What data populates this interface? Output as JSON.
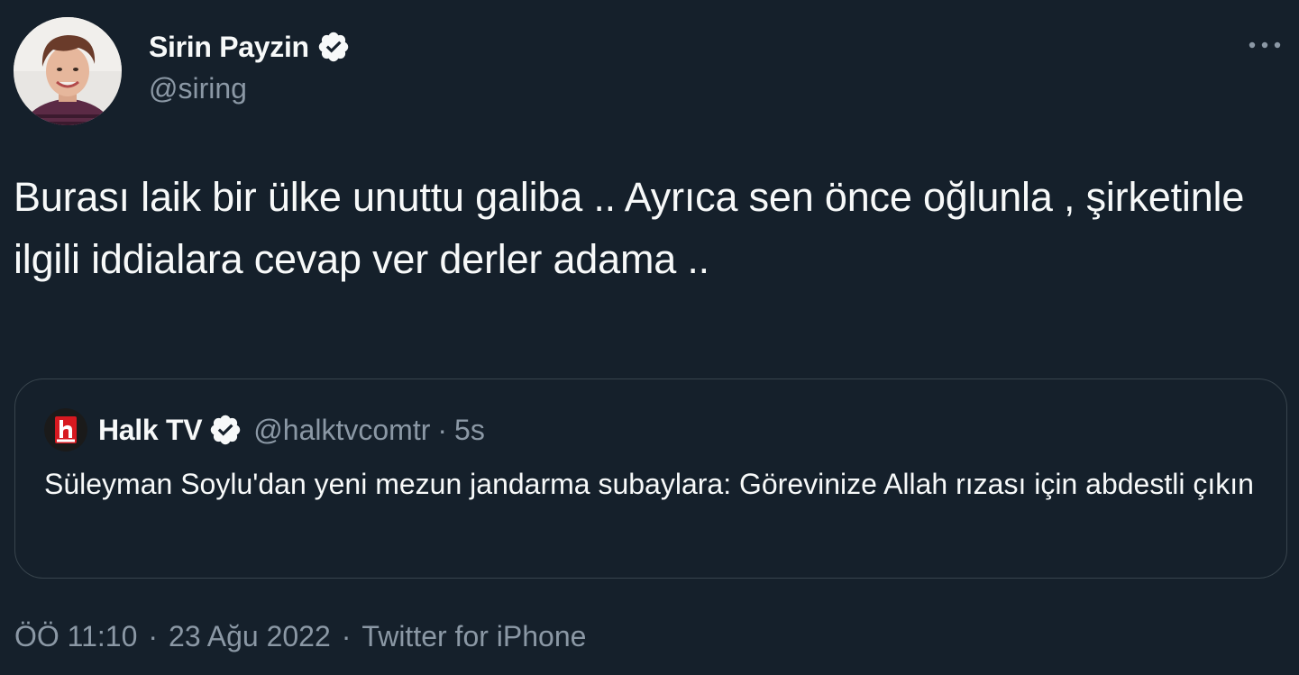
{
  "author": {
    "display_name": "Sirin Payzin",
    "handle": "@siring",
    "verified": true,
    "avatar": "profile-photo"
  },
  "tweet": {
    "text": "Burası laik bir ülke unuttu galiba .. Ayrıca sen önce oğlunla , şirketinle ilgili iddialara cevap ver derler adama .."
  },
  "quoted_tweet": {
    "display_name": "Halk TV",
    "handle": "@halktvcomtr",
    "separator": "·",
    "time": "5s",
    "verified": true,
    "avatar": "halk-tv-logo",
    "text": "Süleyman Soylu'dan yeni mezun jandarma subaylara: Görevinize Allah rızası için abdestli çıkın"
  },
  "meta": {
    "time": "ÖÖ 11:10",
    "separator": "·",
    "date": "23 Ağu 2022",
    "source": "Twitter for iPhone"
  },
  "icons": {
    "more": "more-horizontal-icon",
    "verified": "verified-badge-icon"
  },
  "colors": {
    "background": "#15202b",
    "text_primary": "#f7f9f9",
    "text_secondary": "#8b98a5",
    "border": "#38444d",
    "verified_badge": "#f7f9f9",
    "halk_red": "#d71920"
  }
}
